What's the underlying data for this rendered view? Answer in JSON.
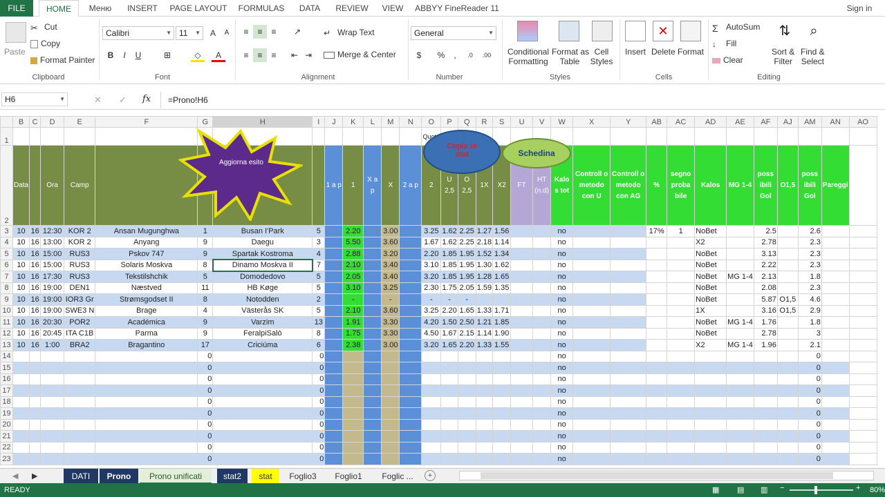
{
  "ribbon_tabs": [
    "FILE",
    "HOME",
    "Меню",
    "INSERT",
    "PAGE LAYOUT",
    "FORMULAS",
    "DATA",
    "REVIEW",
    "VIEW",
    "ABBYY FineReader 11"
  ],
  "sign_in": "Sign in",
  "clipboard": {
    "paste": "Paste",
    "cut": "Cut",
    "copy": "Copy",
    "format_painter": "Format Painter",
    "label": "Clipboard"
  },
  "font": {
    "name": "Calibri",
    "size": "11",
    "label": "Font",
    "bold": "B",
    "italic": "I",
    "underline": "U"
  },
  "alignment": {
    "wrap": "Wrap Text",
    "merge": "Merge & Center",
    "label": "Alignment"
  },
  "number": {
    "format": "General",
    "currency": "$",
    "percent": "%",
    "comma": ",",
    "label": "Number"
  },
  "styles": {
    "cond": "Conditional",
    "cond2": "Formatting",
    "fmt_table": "Format as",
    "fmt_table2": "Table",
    "cell_styles": "Cell",
    "cell_styles2": "Styles",
    "label": "Styles"
  },
  "cells": {
    "insert": "Insert",
    "delete": "Delete",
    "format": "Format",
    "label": "Cells"
  },
  "editing": {
    "autosum": "AutoSum",
    "fill": "Fill",
    "clear": "Clear",
    "sort": "Sort &",
    "sort2": "Filter",
    "find": "Find &",
    "find2": "Select",
    "label": "Editing"
  },
  "name_box": "H6",
  "fx": "fx",
  "formula": "=Prono!H6",
  "columns": [
    "B",
    "C",
    "D",
    "E",
    "F",
    "G",
    "H",
    "I",
    "J",
    "K",
    "L",
    "M",
    "N",
    "O",
    "P",
    "Q",
    "R",
    "S",
    "U",
    "V",
    "W",
    "X",
    "Y",
    "AB",
    "AC",
    "AD",
    "AE",
    "AF",
    "AJ",
    "AM",
    "AN",
    "AO"
  ],
  "headers": {
    "quote": "Quote",
    "data": "Data",
    "ora": "Ora",
    "camp": "Camp",
    "star": "Aggiorna esito",
    "oval_red": "Copia in stat",
    "oval_green": "Schedina",
    "j": "1 a p",
    "k": "1",
    "l": "X a p",
    "m": "X",
    "n": "2 a p",
    "o": "2",
    "p": "U 2,5",
    "q": "O 2,5",
    "r": "1X",
    "s": "X2",
    "u": "FT",
    "v": "HT (n.d)",
    "w": "Kalo s tot",
    "x": "Controll o metodo con U",
    "y": "Controll o metodo con AG",
    "ab": "%",
    "ac": "segno proba bile",
    "ad": "Kalos",
    "ae": "MG 1-4",
    "af": "poss ibili Gol",
    "aj": "O1,5",
    "am": "poss ibili Gol",
    "an": "Pareggi"
  },
  "rows": [
    {
      "r": "3",
      "b": "10",
      "c": "16",
      "d": "12:30",
      "e": "KOR 2",
      "f": "Ansan Mugunghwa",
      "g": "1",
      "h": "Busan I'Park",
      "i": "5",
      "k": "2.20",
      "m": "3.00",
      "o": "3.25",
      "p": "1.62",
      "q": "2.25",
      "rr": "1.27",
      "s": "1.56",
      "w": "no",
      "ab": "17%",
      "ac": "1",
      "ad": "NoBet",
      "ae": "",
      "af": "2.5",
      "aj": "",
      "am": "2.6"
    },
    {
      "r": "4",
      "b": "10",
      "c": "16",
      "d": "13:00",
      "e": "KOR 2",
      "f": "Anyang",
      "g": "9",
      "h": "Daegu",
      "i": "3",
      "k": "5.50",
      "m": "3.60",
      "o": "1.67",
      "p": "1.62",
      "q": "2.25",
      "rr": "2.18",
      "s": "1.14",
      "w": "no",
      "ab": "",
      "ac": "",
      "ad": "X2",
      "ae": "",
      "af": "2.78",
      "aj": "",
      "am": "2.3"
    },
    {
      "r": "5",
      "b": "10",
      "c": "16",
      "d": "15:00",
      "e": "RUS3",
      "f": "Pskov 747",
      "g": "9",
      "h": "Spartak Kostroma",
      "i": "4",
      "k": "2.88",
      "m": "3.20",
      "o": "2.20",
      "p": "1.85",
      "q": "1.95",
      "rr": "1.52",
      "s": "1.34",
      "w": "no",
      "ab": "",
      "ac": "",
      "ad": "NoBet",
      "ae": "",
      "af": "3.13",
      "aj": "",
      "am": "2.3"
    },
    {
      "r": "6",
      "b": "10",
      "c": "16",
      "d": "15:00",
      "e": "RUS3",
      "f": "Solaris Moskva",
      "g": "8",
      "h": "Dinamo Moskva II",
      "i": "7",
      "k": "2.10",
      "m": "3.40",
      "o": "3.10",
      "p": "1.85",
      "q": "1.95",
      "rr": "1.30",
      "s": "1.62",
      "w": "no",
      "ab": "",
      "ac": "",
      "ad": "NoBet",
      "ae": "",
      "af": "2.22",
      "aj": "",
      "am": "2.3"
    },
    {
      "r": "7",
      "b": "10",
      "c": "16",
      "d": "17:30",
      "e": "RUS3",
      "f": "Tekstilshchik",
      "g": "5",
      "h": "Domodedovo",
      "i": "5",
      "k": "2.05",
      "m": "3.40",
      "o": "3.20",
      "p": "1.85",
      "q": "1.95",
      "rr": "1.28",
      "s": "1.65",
      "w": "no",
      "ab": "",
      "ac": "",
      "ad": "NoBet",
      "ae": "MG 1-4",
      "af": "2.13",
      "aj": "",
      "am": "1.8"
    },
    {
      "r": "8",
      "b": "10",
      "c": "16",
      "d": "19:00",
      "e": "DEN1",
      "f": "Næstved",
      "g": "11",
      "h": "HB Køge",
      "i": "5",
      "k": "3.10",
      "m": "3.25",
      "o": "2.30",
      "p": "1.75",
      "q": "2.05",
      "rr": "1.59",
      "s": "1.35",
      "w": "no",
      "ab": "",
      "ac": "",
      "ad": "NoBet",
      "ae": "",
      "af": "2.08",
      "aj": "",
      "am": "2.3"
    },
    {
      "r": "9",
      "b": "10",
      "c": "16",
      "d": "19:00",
      "e": "IOR3 Gr",
      "f": "Strømsgodset II",
      "g": "8",
      "h": "Notodden",
      "i": "2",
      "k": "-",
      "m": "-",
      "o": "-",
      "p": "-",
      "q": "-",
      "rr": "",
      "s": "",
      "w": "no",
      "ab": "",
      "ac": "",
      "ad": "NoBet",
      "ae": "",
      "af": "5.87",
      "aj": "O1,5",
      "am": "4.6"
    },
    {
      "r": "10",
      "b": "10",
      "c": "16",
      "d": "19:00",
      "e": "SWE3 N",
      "f": "Brage",
      "g": "4",
      "h": "Västerås SK",
      "i": "5",
      "k": "2.10",
      "m": "3.60",
      "o": "3.25",
      "p": "2.20",
      "q": "1.65",
      "rr": "1.33",
      "s": "1.71",
      "w": "no",
      "ab": "",
      "ac": "",
      "ad": "1X",
      "ae": "",
      "af": "3.16",
      "aj": "O1,5",
      "am": "2.9"
    },
    {
      "r": "11",
      "b": "10",
      "c": "16",
      "d": "20:30",
      "e": "POR2",
      "f": "Académica",
      "g": "9",
      "h": "Varzim",
      "i": "13",
      "k": "1.91",
      "m": "3.30",
      "o": "4.20",
      "p": "1.50",
      "q": "2.50",
      "rr": "1.21",
      "s": "1.85",
      "w": "no",
      "ab": "",
      "ac": "",
      "ad": "NoBet",
      "ae": "MG 1-4",
      "af": "1.76",
      "aj": "",
      "am": "1.8"
    },
    {
      "r": "12",
      "b": "10",
      "c": "16",
      "d": "20:45",
      "e": "ITA C1B",
      "f": "Parma",
      "g": "9",
      "h": "FeralpiSalò",
      "i": "8",
      "k": "1.75",
      "m": "3.30",
      "o": "4.50",
      "p": "1.67",
      "q": "2.15",
      "rr": "1.14",
      "s": "1.90",
      "w": "no",
      "ab": "",
      "ac": "",
      "ad": "NoBet",
      "ae": "",
      "af": "2.78",
      "aj": "",
      "am": "3"
    },
    {
      "r": "13",
      "b": "10",
      "c": "16",
      "d": "1:00",
      "e": "BRA2",
      "f": "Bragantino",
      "g": "17",
      "h": "Criciúma",
      "i": "6",
      "k": "2.38",
      "m": "3.00",
      "o": "3.20",
      "p": "1.65",
      "q": "2.20",
      "rr": "1.33",
      "s": "1.55",
      "w": "no",
      "ab": "",
      "ac": "",
      "ad": "X2",
      "ae": "MG 1-4",
      "af": "1.96",
      "aj": "",
      "am": "2.1"
    }
  ],
  "empty_rows": [
    "14",
    "15",
    "16",
    "17",
    "18",
    "19",
    "20",
    "21",
    "22",
    "23"
  ],
  "empty_values": {
    "g": "0",
    "i": "0",
    "w": "no",
    "am": "0"
  },
  "sheet_tabs": [
    "DATI",
    "Prono",
    "Prono unificati",
    "stat2",
    "stat",
    "Foglio3",
    "Foglio1",
    "Foglic ..."
  ],
  "status_left": "READY",
  "zoom": "80%",
  "colors": {
    "excel_green": "#217346",
    "header_olive": "#778d45",
    "bright_green": "#33dd33",
    "purple": "#b4a7d6",
    "blue_col": "#5b8fd8",
    "tan_col": "#c4b98c",
    "odd_row": "#c6d9f1"
  }
}
